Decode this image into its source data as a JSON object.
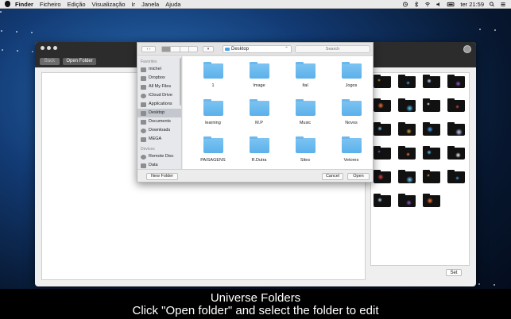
{
  "menubar": {
    "items": [
      "Finder",
      "Ficheiro",
      "Edição",
      "Visualização",
      "Ir",
      "Janela",
      "Ajuda"
    ],
    "clock": "ter 21:59"
  },
  "app_window": {
    "back_label": "Back",
    "open_folder_label": "Open Folder",
    "set_label": "Set",
    "thumbnail_count": 23
  },
  "open_panel": {
    "location": "Desktop",
    "search_placeholder": "Search",
    "sidebar": {
      "favorites_header": "Favorites",
      "favorites": [
        "michel",
        "Dropbox",
        "All My Files",
        "iCloud Drive",
        "Applications",
        "Desktop",
        "Documents",
        "Downloads",
        "MEGA"
      ],
      "selected": "Desktop",
      "devices_header": "Devices",
      "devices": [
        "Remote Disc",
        "Data"
      ]
    },
    "files": [
      "1",
      "Image",
      "Ital",
      "Jogos",
      "learning",
      "M.P",
      "Music",
      "Novos",
      "PAISAGENS",
      "R.Dutra",
      "Sites",
      "Vetores"
    ],
    "new_folder_label": "New Folder",
    "cancel_label": "Cancel",
    "open_label": "Open"
  },
  "caption": {
    "title": "Universe Folders",
    "subtitle": "Click \"Open folder\" and select the folder to edit"
  },
  "colors": {
    "folder_blue": "#5bb0ea",
    "caption_bg": "#000000",
    "desktop_blue": "#123a73"
  }
}
